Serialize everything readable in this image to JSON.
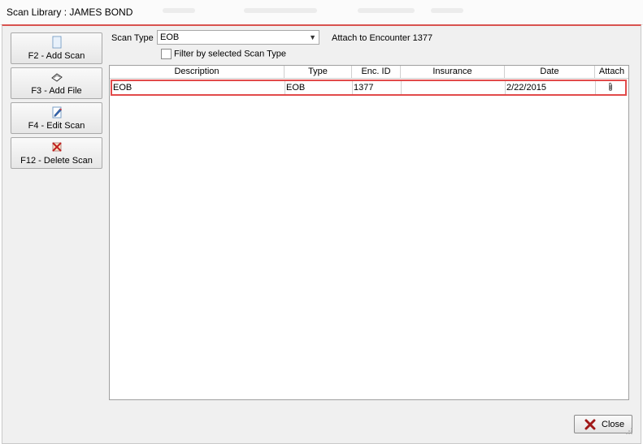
{
  "window": {
    "title": "Scan Library : JAMES BOND"
  },
  "sidebar": {
    "buttons": [
      {
        "label": "F2 - Add Scan",
        "icon": "blank-page-icon"
      },
      {
        "label": "F3 - Add File",
        "icon": "open-file-icon"
      },
      {
        "label": "F4 - Edit Scan",
        "icon": "edit-pencil-icon"
      },
      {
        "label": "F12 - Delete Scan",
        "icon": "delete-x-icon"
      }
    ]
  },
  "toolbar": {
    "scan_type_label": "Scan Type",
    "scan_type_value": "EOB",
    "attach_label": "Attach to Encounter 1377",
    "filter_label": "Filter by selected Scan Type",
    "filter_checked": false
  },
  "grid": {
    "columns": [
      "Description",
      "Type",
      "Enc. ID",
      "Insurance",
      "Date",
      "Attach"
    ],
    "rows": [
      {
        "description": "EOB",
        "type": "EOB",
        "enc_id": "1377",
        "insurance": "",
        "date": "2/22/2015",
        "attach_icon": "paperclip-icon"
      }
    ]
  },
  "footer": {
    "close_label": "Close"
  },
  "colors": {
    "highlight": "#e24a4a",
    "accent_border": "#d9534f"
  }
}
